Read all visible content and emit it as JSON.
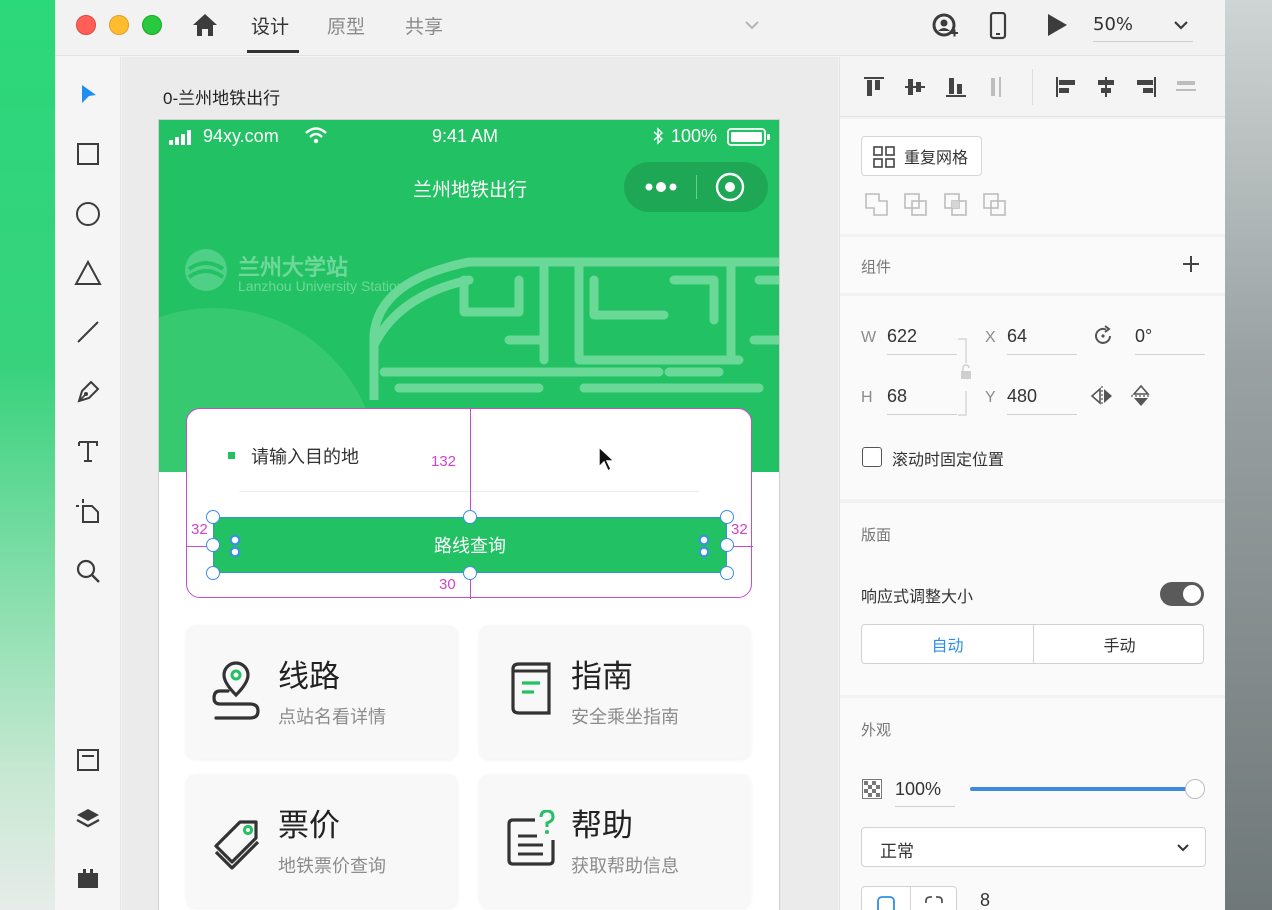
{
  "titlebar": {
    "tabs": [
      {
        "label": "设计",
        "active": true
      },
      {
        "label": "原型",
        "active": false
      },
      {
        "label": "共享",
        "active": false
      }
    ],
    "zoom": "50%"
  },
  "canvas": {
    "artboard_label": "0-兰州地铁出行"
  },
  "phone": {
    "status": {
      "carrier": "94xy.com",
      "time": "9:41 AM",
      "battery": "100%"
    },
    "nav_title": "兰州地铁出行",
    "station_name": "兰州大学站",
    "station_en": "Lanzhou University Station",
    "search_placeholder": "请输入目的地",
    "route_button": "路线查询",
    "dimensions": {
      "top": "132",
      "left": "32",
      "right": "32",
      "bottom": "30"
    },
    "cards": [
      {
        "title": "线路",
        "subtitle": "点站名看详情",
        "icon": "map-pin-route-icon"
      },
      {
        "title": "指南",
        "subtitle": "安全乘坐指南",
        "icon": "book-guide-icon"
      },
      {
        "title": "票价",
        "subtitle": "地铁票价查询",
        "icon": "price-tag-icon"
      },
      {
        "title": "帮助",
        "subtitle": "获取帮助信息",
        "icon": "help-document-icon"
      }
    ],
    "accent_color": "#22c163"
  },
  "panel": {
    "repeat_grid": "重复网格",
    "components_title": "组件",
    "props": {
      "w_label": "W",
      "w": "622",
      "x_label": "X",
      "x": "64",
      "rotation": "0°",
      "h_label": "H",
      "h": "68",
      "y_label": "Y",
      "y": "480"
    },
    "fix_position": "滚动时固定位置",
    "artboard_title": "版面",
    "responsive_resize": "响应式调整大小",
    "responsive_on": true,
    "seg_auto": "自动",
    "seg_manual": "手动",
    "appearance_title": "外观",
    "opacity": "100%",
    "opacity_value": 1.0,
    "blend_mode": "正常",
    "corner_radius": "8",
    "accent_color": "#3d8be0"
  }
}
